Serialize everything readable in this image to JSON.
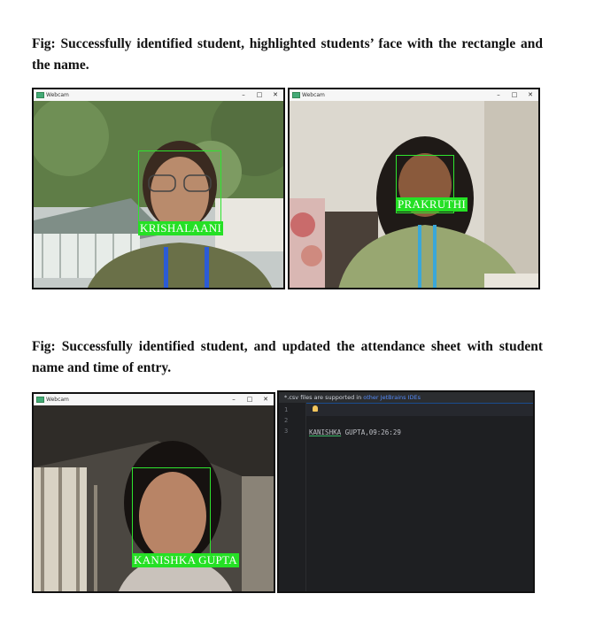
{
  "captions": {
    "first": "Fig: Successfully identified student, highlighted students’ face with the rectangle and the name.",
    "second": "Fig: Successfully identified student, and updated the attendance sheet with student name and time of entry."
  },
  "webcam_windows": [
    {
      "title": "Webcam",
      "controls": {
        "minimize": "–",
        "maximize": "□",
        "close": "✕"
      },
      "student_label": "KRISHALAANI"
    },
    {
      "title": "Webcam",
      "controls": {
        "minimize": "–",
        "maximize": "□",
        "close": "✕"
      },
      "student_label": "PRAKRUTHI"
    },
    {
      "title": "Webcam",
      "controls": {
        "minimize": "–",
        "maximize": "□",
        "close": "✕"
      },
      "student_label": "KANISHKA GUPTA"
    }
  ],
  "editor": {
    "banner_prefix": "*.csv files are supported in",
    "banner_link": "other JetBrains IDEs",
    "line_numbers": [
      "1",
      "2",
      "3"
    ],
    "csv_name": "KANISHKA",
    "csv_rest": " GUPTA,09:26:29"
  },
  "colors": {
    "face_box": "#2ee52e",
    "label_bg": "#25e025",
    "editor_bg": "#1e1f22"
  }
}
